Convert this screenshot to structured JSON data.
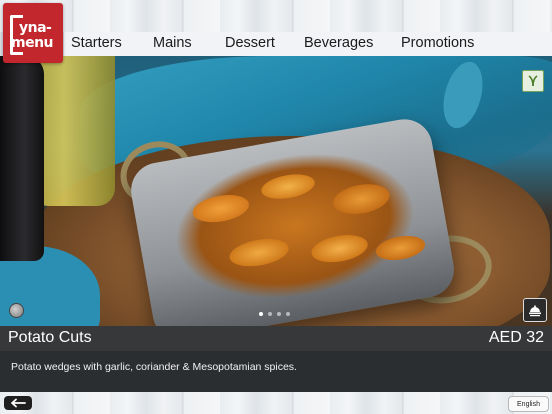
{
  "logo": {
    "line1": "yna-",
    "line2": "menu",
    "brand_color": "#c1272d"
  },
  "nav": {
    "items": [
      {
        "label": "Starters"
      },
      {
        "label": "Mains"
      },
      {
        "label": "Dessert"
      },
      {
        "label": "Beverages"
      },
      {
        "label": "Promotions"
      }
    ]
  },
  "badges": {
    "dietary_icon": "vegetarian-leaf-icon"
  },
  "carousel": {
    "total": 4,
    "active_index": 0
  },
  "dish": {
    "name": "Potato Cuts",
    "price": "AED 32",
    "description": "Potato wedges with garlic, coriander & Mesopotamian spices."
  },
  "footer": {
    "back_icon": "arrow-left-icon",
    "language_label": "English"
  },
  "colors": {
    "overlay_dark": "#141414",
    "veg_green": "#4a7f2a"
  }
}
